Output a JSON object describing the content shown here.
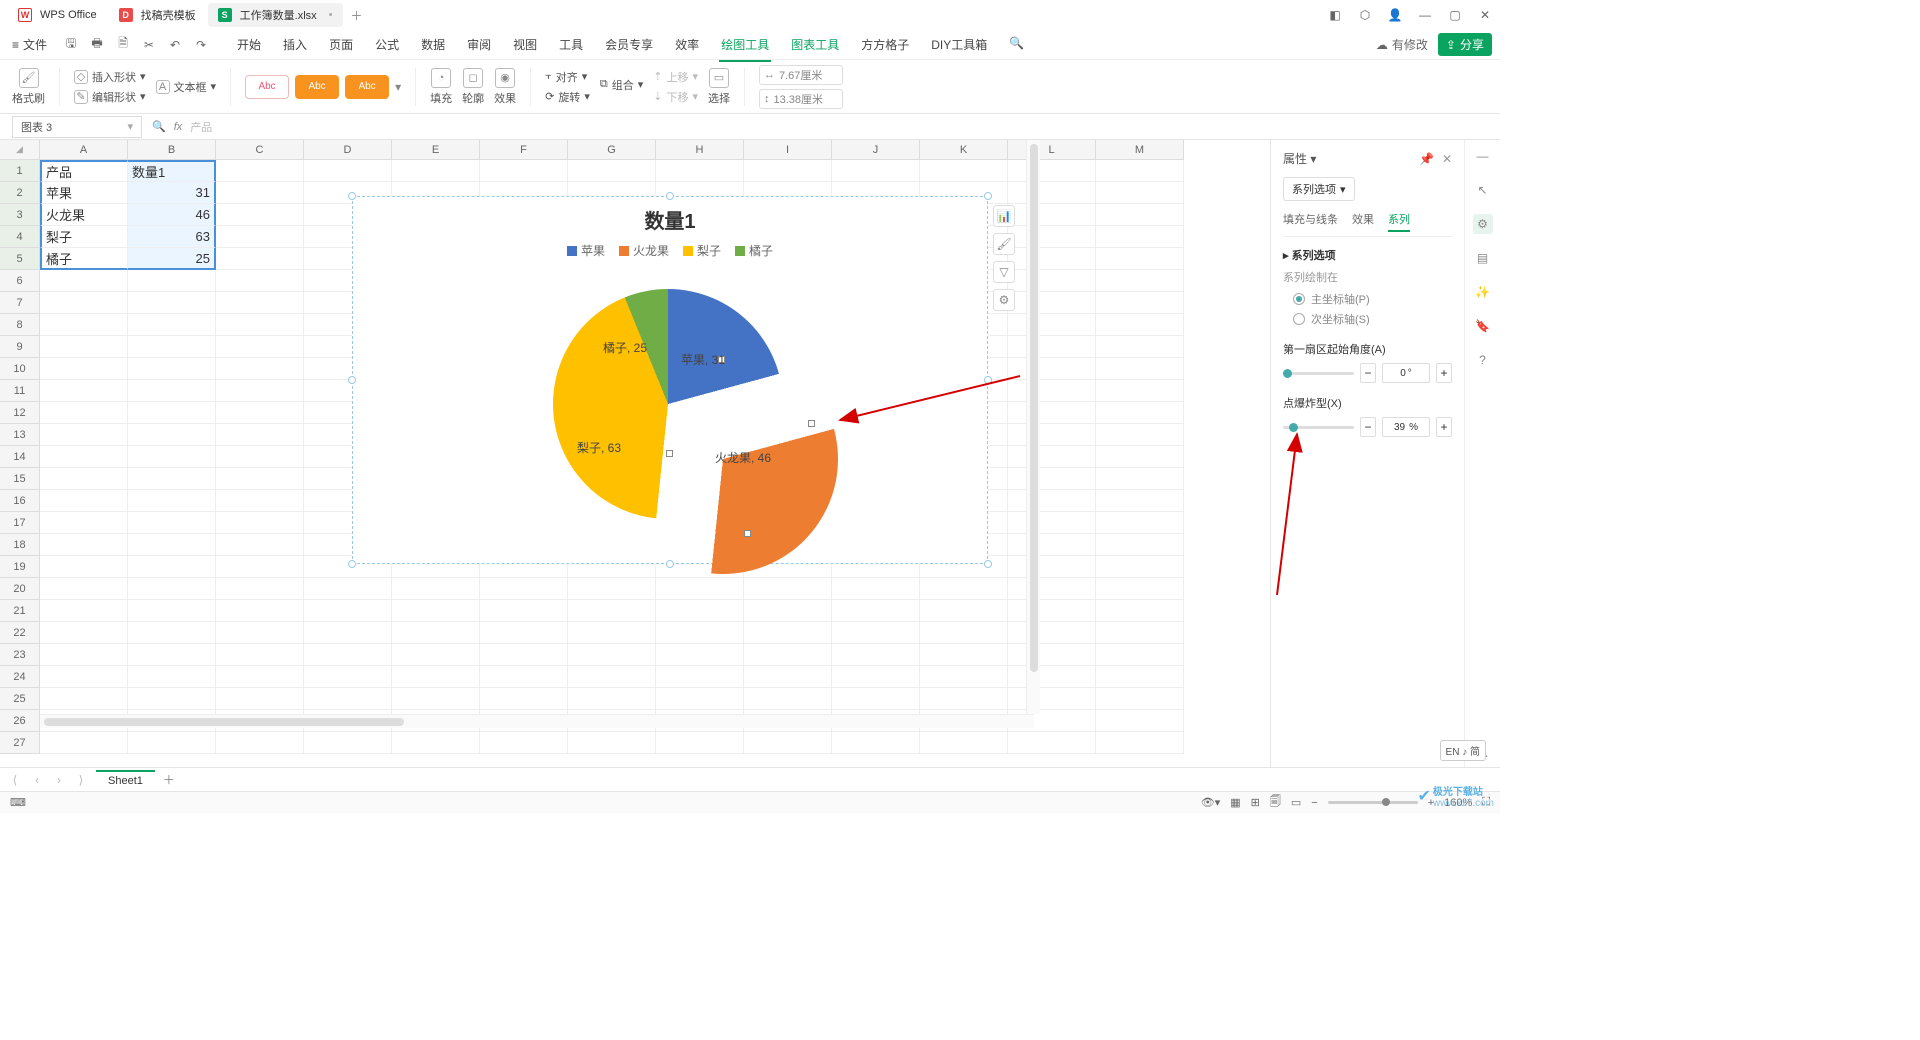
{
  "titlebar": {
    "app_name": "WPS Office",
    "tab_template": "找稿壳模板",
    "tab_file": "工作簿数量.xlsx"
  },
  "menubar": {
    "file": "文件",
    "tabs": {
      "start": "开始",
      "insert": "插入",
      "page": "页面",
      "formula": "公式",
      "data": "数据",
      "review": "审阅",
      "view": "视图",
      "tools": "工具",
      "member": "会员专享",
      "efficiency": "效率",
      "drawtool": "绘图工具",
      "charttool": "图表工具",
      "square": "方方格子",
      "diy": "DIY工具箱"
    },
    "modified": "有修改",
    "share": "分享"
  },
  "ribbon": {
    "format_painter": "格式刷",
    "insert_shape": "插入形状",
    "text_box": "文本框",
    "edit_shape": "编辑形状",
    "abc": "Abc",
    "fill": "填充",
    "outline": "轮廓",
    "effect": "效果",
    "align": "对齐",
    "group": "组合",
    "rotate": "旋转",
    "up": "上移",
    "down": "下移",
    "select": "选择",
    "width": "7.67厘米",
    "height": "13.38厘米"
  },
  "fbar": {
    "name": "图表 3",
    "fx": "fx",
    "content": "产品"
  },
  "columns": [
    "A",
    "B",
    "C",
    "D",
    "E",
    "F",
    "G",
    "H",
    "I",
    "J",
    "K",
    "L",
    "M"
  ],
  "sheet": {
    "header_a": "产品",
    "header_b": "数量1",
    "rows": [
      {
        "a": "苹果",
        "b": "31"
      },
      {
        "a": "火龙果",
        "b": "46"
      },
      {
        "a": "梨子",
        "b": "63"
      },
      {
        "a": "橘子",
        "b": "25"
      }
    ]
  },
  "chart": {
    "title": "数量1",
    "legend": [
      "苹果",
      "火龙果",
      "梨子",
      "橘子"
    ],
    "labels": {
      "apple": "苹果, 31",
      "dragon": "火龙果, 46",
      "pear": "梨子, 63",
      "orange": "橘子, 25"
    }
  },
  "prop": {
    "title": "属性",
    "series_btn": "系列选项",
    "tab_fill": "填充与线条",
    "tab_effect": "效果",
    "tab_series": "系列",
    "sec_series": "系列选项",
    "plot_on": "系列绘制在",
    "primary": "主坐标轴(P)",
    "secondary": "次坐标轴(S)",
    "angle_label": "第一扇区起始角度(A)",
    "angle_val": "0",
    "angle_unit": "°",
    "explode_label": "点爆炸型(X)",
    "explode_val": "39",
    "explode_unit": "%"
  },
  "sheet_tabs": {
    "sheet1": "Sheet1"
  },
  "status": {
    "zoom": "160%",
    "ime": "EN ♪ 简"
  },
  "watermark": {
    "t1": "极光下载站",
    "t2": "www.xz7.com"
  },
  "chart_data": {
    "type": "pie",
    "title": "数量1",
    "categories": [
      "苹果",
      "火龙果",
      "梨子",
      "橘子"
    ],
    "values": [
      31,
      46,
      63,
      25
    ],
    "colors": [
      "#4472c4",
      "#ed7d31",
      "#ffc000",
      "#70ad47"
    ],
    "exploded_index": 1,
    "explosion_percent": 39,
    "start_angle_deg": 0,
    "data_labels": "category,value",
    "legend_position": "top"
  }
}
